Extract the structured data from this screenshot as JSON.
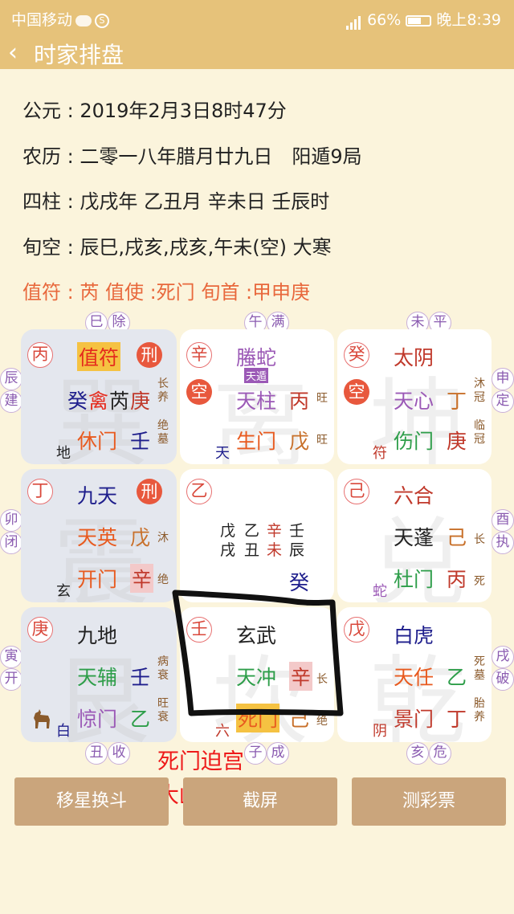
{
  "status": {
    "carrier": "中国移动",
    "battery": "66%",
    "time": "晚上8:39"
  },
  "header": {
    "title": "时家排盘"
  },
  "info": {
    "gongyuan": "公元 : 2019年2月3日8时47分",
    "nongli": "农历 : 二零一八年腊月廿九日　阳遁9局",
    "sizhu": "四柱 : 戊戌年 乙丑月 辛未日 壬辰时",
    "xunkong": "旬空 : 辰巳,戌亥,戌亥,午未(空)  大寒",
    "zhifu_line": "值符 : 芮  值使 :死门  旬首 :甲申庚"
  },
  "labels": {
    "t1": "巳",
    "t2": "除",
    "t3": "午",
    "t4": "满",
    "t5": "未",
    "t6": "平",
    "l1": "辰",
    "l2": "建",
    "l3": "卯",
    "l4": "闭",
    "l5": "寅",
    "l6": "开",
    "r1": "申",
    "r2": "定",
    "r3": "酉",
    "r4": "执",
    "r5": "戌",
    "r6": "破",
    "b1": "丑",
    "b2": "收",
    "b3": "子",
    "b4": "成",
    "b5": "亥",
    "b6": "危"
  },
  "palace": {
    "p1": {
      "stem": "丙",
      "god": "值符",
      "xing": "刑",
      "lb": "癸",
      "lc": "禽",
      "ld": "芮",
      "le": "庚",
      "s1": "长",
      "s2": "养",
      "m": "休门",
      "mv": "壬",
      "s3": "绝",
      "s4": "墓",
      "d": "地",
      "wm": "巽"
    },
    "p2": {
      "stem": "辛",
      "god": "螣蛇",
      "badge": "天遁",
      "kong": "空",
      "star": "天柱",
      "sv": "丙",
      "s1": "旺",
      "m": "生门",
      "mv": "戊",
      "s2": "旺",
      "d": "天",
      "wm": "离"
    },
    "p3": {
      "stem": "癸",
      "god": "太阴",
      "kong": "空",
      "star": "天心",
      "sv": "丁",
      "s1": "沐",
      "s2": "冠",
      "m": "伤门",
      "mv": "庚",
      "s3": "临",
      "s4": "冠",
      "d": "符",
      "wm": "坤"
    },
    "p4": {
      "stem": "丁",
      "god": "九天",
      "xing": "刑",
      "star": "天英",
      "sv": "戊",
      "s1": "沐",
      "m": "开门",
      "mv": "辛",
      "s2": "绝",
      "d": "玄",
      "wm": "震"
    },
    "p5": {
      "stem": "乙",
      "g1": "戊",
      "g2": "乙",
      "g3": "辛",
      "g4": "壬",
      "g5": "戌",
      "g6": "丑",
      "g7": "未",
      "g8": "辰",
      "bottom": "癸"
    },
    "p6": {
      "stem": "己",
      "god": "六合",
      "star": "天蓬",
      "sv": "己",
      "s1": "长",
      "m": "杜门",
      "mv": "丙",
      "s2": "死",
      "d": "蛇",
      "wm": "兑"
    },
    "p7": {
      "stem": "庚",
      "god": "九地",
      "star": "天辅",
      "sv": "壬",
      "s1": "病",
      "s2": "衰",
      "m": "惊门",
      "mv": "乙",
      "s3": "旺",
      "s4": "衰",
      "d": "白",
      "wm": "艮"
    },
    "p8": {
      "stem": "壬",
      "god": "玄武",
      "star": "天冲",
      "sv": "辛",
      "s1": "长",
      "m": "死门",
      "mv": "己",
      "s2": "绝",
      "d": "六",
      "wm": "坎"
    },
    "p9": {
      "stem": "戊",
      "god": "白虎",
      "star": "天任",
      "sv": "乙",
      "s1": "死",
      "s2": "墓",
      "m": "景门",
      "mv": "丁",
      "s3": "胎",
      "s4": "养",
      "d": "阴",
      "wm": "乾"
    }
  },
  "buttons": {
    "b1": "移星换斗",
    "b2": "截屏",
    "b3": "测彩票"
  },
  "annotation": {
    "line1": "死门迫宫",
    "line2": "大凶"
  }
}
